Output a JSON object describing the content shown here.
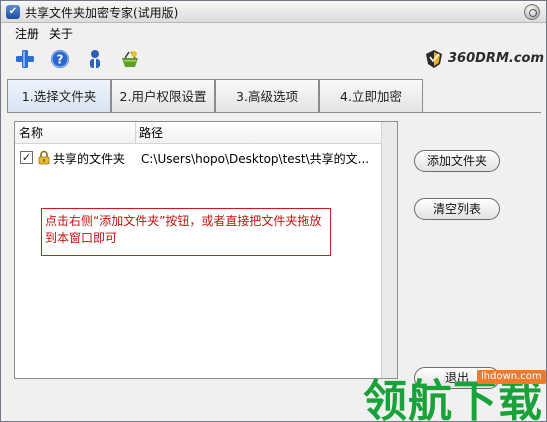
{
  "window": {
    "title": "共享文件夹加密专家(试用版)"
  },
  "menu": {
    "items": [
      {
        "label": "注册"
      },
      {
        "label": "关于"
      }
    ]
  },
  "toolbar": {
    "icons": [
      "add-icon",
      "help-icon",
      "user-icon",
      "basket-icon"
    ],
    "logo_text": "360DRM.com"
  },
  "tabs": [
    {
      "label": "1.选择文件夹",
      "active": true
    },
    {
      "label": "2.用户权限设置",
      "active": false
    },
    {
      "label": "3.高级选项",
      "active": false
    },
    {
      "label": "4.立即加密",
      "active": false
    }
  ],
  "list": {
    "columns": [
      "名称",
      "路径"
    ],
    "rows": [
      {
        "checked": true,
        "name": "共享的文件夹",
        "path": "C:\\Users\\hopo\\Desktop\\test\\共享的文..."
      }
    ]
  },
  "hint": {
    "text": "点击右侧“添加文件夹”按钮，或者直接把文件夹拖放到本窗口即可"
  },
  "buttons": {
    "add_folder": "添加文件夹",
    "clear_list": "清空列表",
    "exit": "退出"
  },
  "watermark": {
    "text": "领航下载",
    "sub": "lhdown.com"
  },
  "colors": {
    "hint_border": "#c81c1c",
    "hint_text": "#c0140e",
    "watermark_green": "#19a23a",
    "watermark_orange": "#f07a2a"
  }
}
